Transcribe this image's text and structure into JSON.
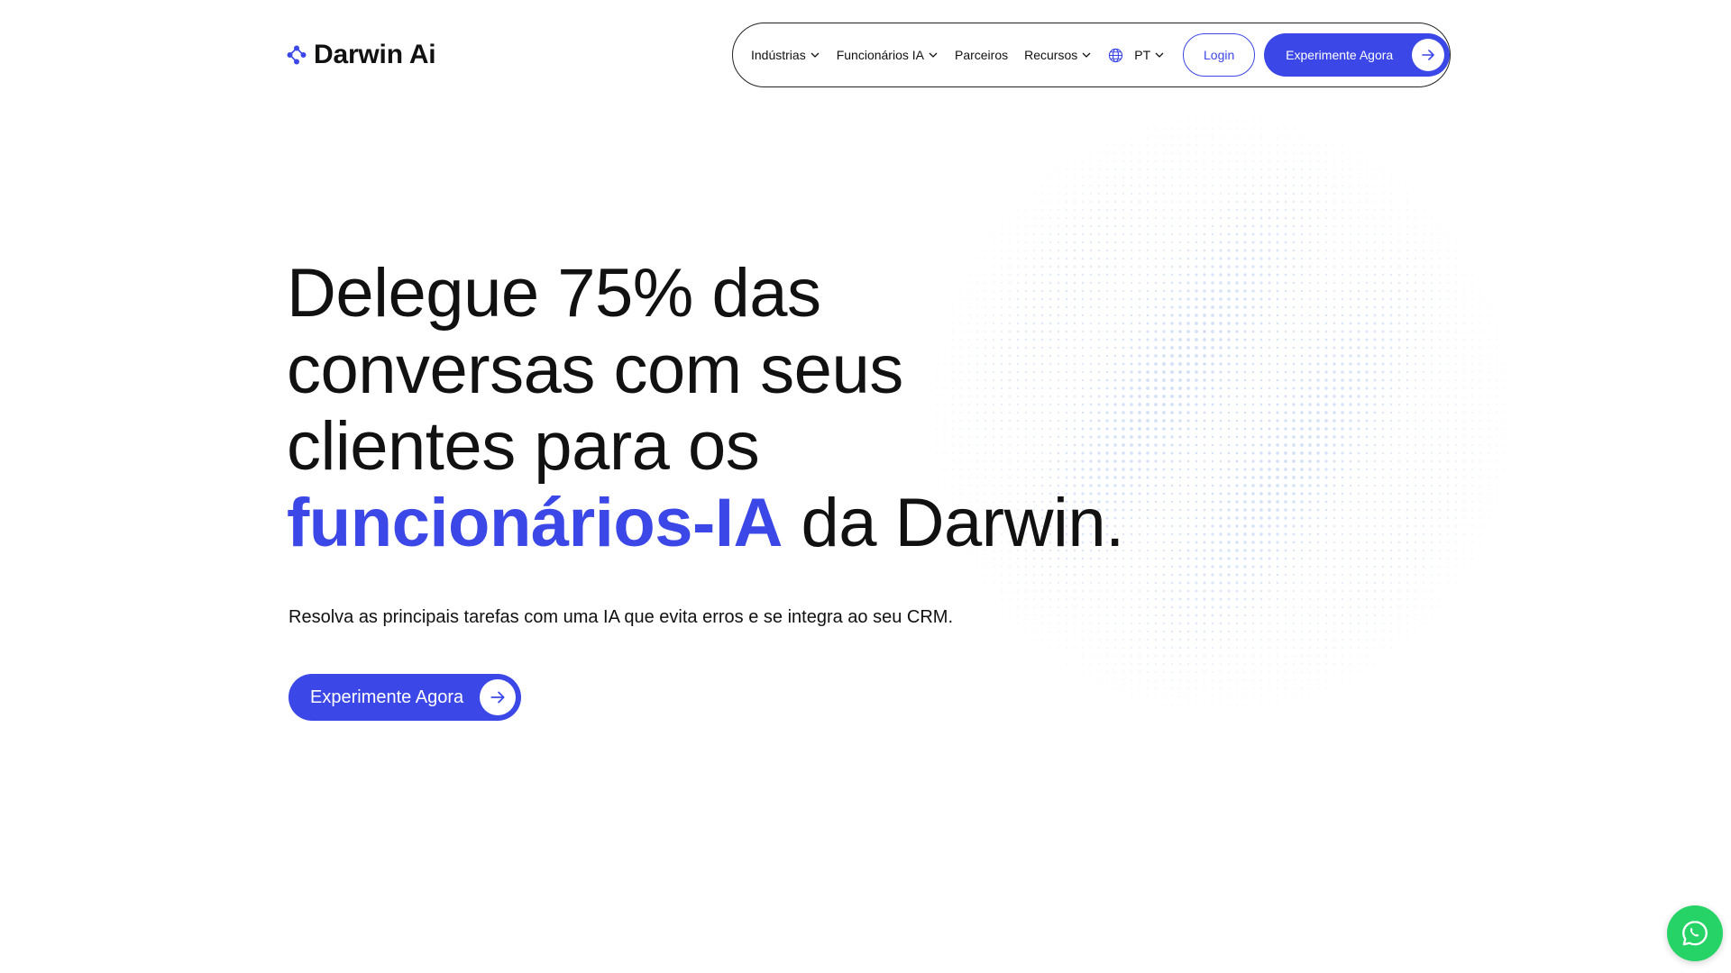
{
  "brand": {
    "name": "Darwin Ai",
    "accent_color": "#3b47e6"
  },
  "nav": {
    "items": [
      {
        "label": "Indústrias",
        "has_dropdown": true
      },
      {
        "label": "Funcionários IA",
        "has_dropdown": true
      },
      {
        "label": "Parceiros",
        "has_dropdown": false
      },
      {
        "label": "Recursos",
        "has_dropdown": true
      }
    ],
    "language": "PT",
    "login_label": "Login",
    "cta_label": "Experimente Agora"
  },
  "hero": {
    "headline_line1": "Delegue 75% das",
    "headline_line2": "conversas com seus",
    "headline_line3": "clientes para os",
    "headline_accent": "funcionários-IA",
    "headline_tail": " da Darwin.",
    "subtitle": "Resolva as principais tarefas com uma IA que evita erros e se integra ao seu CRM.",
    "cta_label": "Experimente Agora"
  },
  "icons": {
    "logo": "darwin-logo-icon",
    "globe": "globe-icon",
    "arrow": "arrow-right-icon",
    "whatsapp": "whatsapp-icon"
  },
  "colors": {
    "whatsapp": "#25d366",
    "sphere_dots": "#c9d9f5"
  }
}
